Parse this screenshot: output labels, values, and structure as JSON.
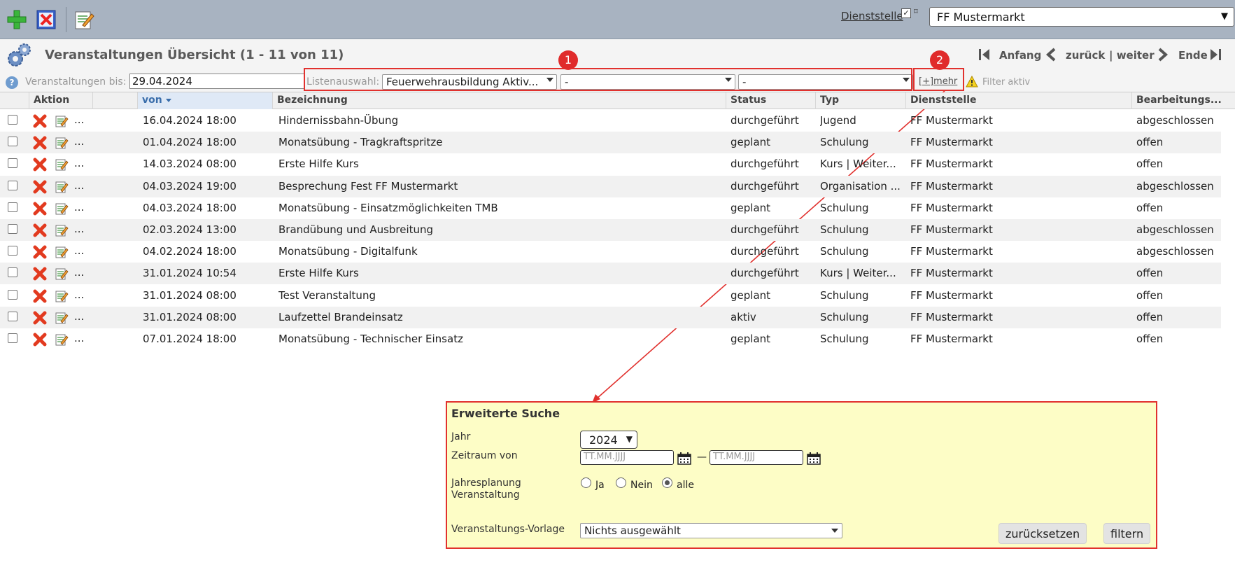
{
  "toolbar": {
    "add_icon": "plus-icon",
    "delete_icon": "delete-icon",
    "edit_icon": "edit-icon",
    "service_link": "Dienststelle",
    "service_value": "FF Mustermarkt"
  },
  "header": {
    "title": "Veranstaltungen Übersicht (1 - 11 von 11)",
    "pager": {
      "first": "Anfang",
      "prev": "zurück",
      "next": "| weiter",
      "last": "Ende"
    }
  },
  "filter": {
    "date_label": "Veranstaltungen bis:",
    "date_value": "29.04.2024",
    "list_label": "Listenauswahl:",
    "list_select_1": "Feuerwehrausbildung Aktiv...",
    "list_select_2": "-",
    "list_select_3": "-",
    "more_link": "[+]mehr",
    "filter_status": "Filter aktiv"
  },
  "callouts": [
    "1",
    "2"
  ],
  "table": {
    "columns": [
      "Aktion",
      "von",
      "Bezeichnung",
      "Status",
      "Typ",
      "Dienststelle",
      "Bearbeitungs..."
    ],
    "row_dots": "...",
    "rows": [
      {
        "von": "16.04.2024 18:00",
        "bez": "Hindernissbahn-Übung",
        "status": "durchgeführt",
        "typ": "Jugend",
        "ds": "FF Mustermarkt",
        "bearb": "abgeschlossen"
      },
      {
        "von": "01.04.2024 18:00",
        "bez": "Monatsübung - Tragkraftspritze",
        "status": "geplant",
        "typ": "Schulung",
        "ds": "FF Mustermarkt",
        "bearb": "offen"
      },
      {
        "von": "14.03.2024 08:00",
        "bez": "Erste Hilfe Kurs",
        "status": "durchgeführt",
        "typ": "Kurs | Weiter...",
        "ds": "FF Mustermarkt",
        "bearb": "offen"
      },
      {
        "von": "04.03.2024 19:00",
        "bez": "Besprechung Fest FF Mustermarkt",
        "status": "durchgeführt",
        "typ": "Organisation ...",
        "ds": "FF Mustermarkt",
        "bearb": "abgeschlossen"
      },
      {
        "von": "04.03.2024 18:00",
        "bez": "Monatsübung - Einsatzmöglichkeiten TMB",
        "status": "geplant",
        "typ": "Schulung",
        "ds": "FF Mustermarkt",
        "bearb": "offen"
      },
      {
        "von": "02.03.2024 13:00",
        "bez": "Brandübung und Ausbreitung",
        "status": "durchgeführt",
        "typ": "Schulung",
        "ds": "FF Mustermarkt",
        "bearb": "abgeschlossen"
      },
      {
        "von": "04.02.2024 18:00",
        "bez": "Monatsübung - Digitalfunk",
        "status": "durchgeführt",
        "typ": "Schulung",
        "ds": "FF Mustermarkt",
        "bearb": "abgeschlossen"
      },
      {
        "von": "31.01.2024 10:54",
        "bez": "Erste Hilfe Kurs",
        "status": "durchgeführt",
        "typ": "Kurs | Weiter...",
        "ds": "FF Mustermarkt",
        "bearb": "offen"
      },
      {
        "von": "31.01.2024 08:00",
        "bez": "Test Veranstaltung",
        "status": "geplant",
        "typ": "Schulung",
        "ds": "FF Mustermarkt",
        "bearb": "offen"
      },
      {
        "von": "31.01.2024 08:00",
        "bez": "Laufzettel Brandeinsatz",
        "status": "aktiv",
        "typ": "Schulung",
        "ds": "FF Mustermarkt",
        "bearb": "offen"
      },
      {
        "von": "07.01.2024 18:00",
        "bez": "Monatsübung - Technischer Einsatz",
        "status": "geplant",
        "typ": "Schulung",
        "ds": "FF Mustermarkt",
        "bearb": "offen"
      }
    ]
  },
  "advanced_search": {
    "title": "Erweiterte Suche",
    "year_label": "Jahr",
    "year_value": "2024",
    "period_label": "Zeitraum von",
    "date_placeholder": "TT.MM.JJJJ",
    "dash": "—",
    "planning_label_1": "Jahresplanung",
    "planning_label_2": "Veranstaltung",
    "radio_yes": "Ja",
    "radio_no": "Nein",
    "radio_all": "alle",
    "template_label": "Veranstaltungs-Vorlage",
    "template_value": "Nichts ausgewählt",
    "reset_button": "zurücksetzen",
    "filter_button": "filtern"
  },
  "colors": {
    "accent_red": "#e1312e",
    "panel_bg": "#fdfdc6",
    "header_bg": "#a8b3c1"
  }
}
